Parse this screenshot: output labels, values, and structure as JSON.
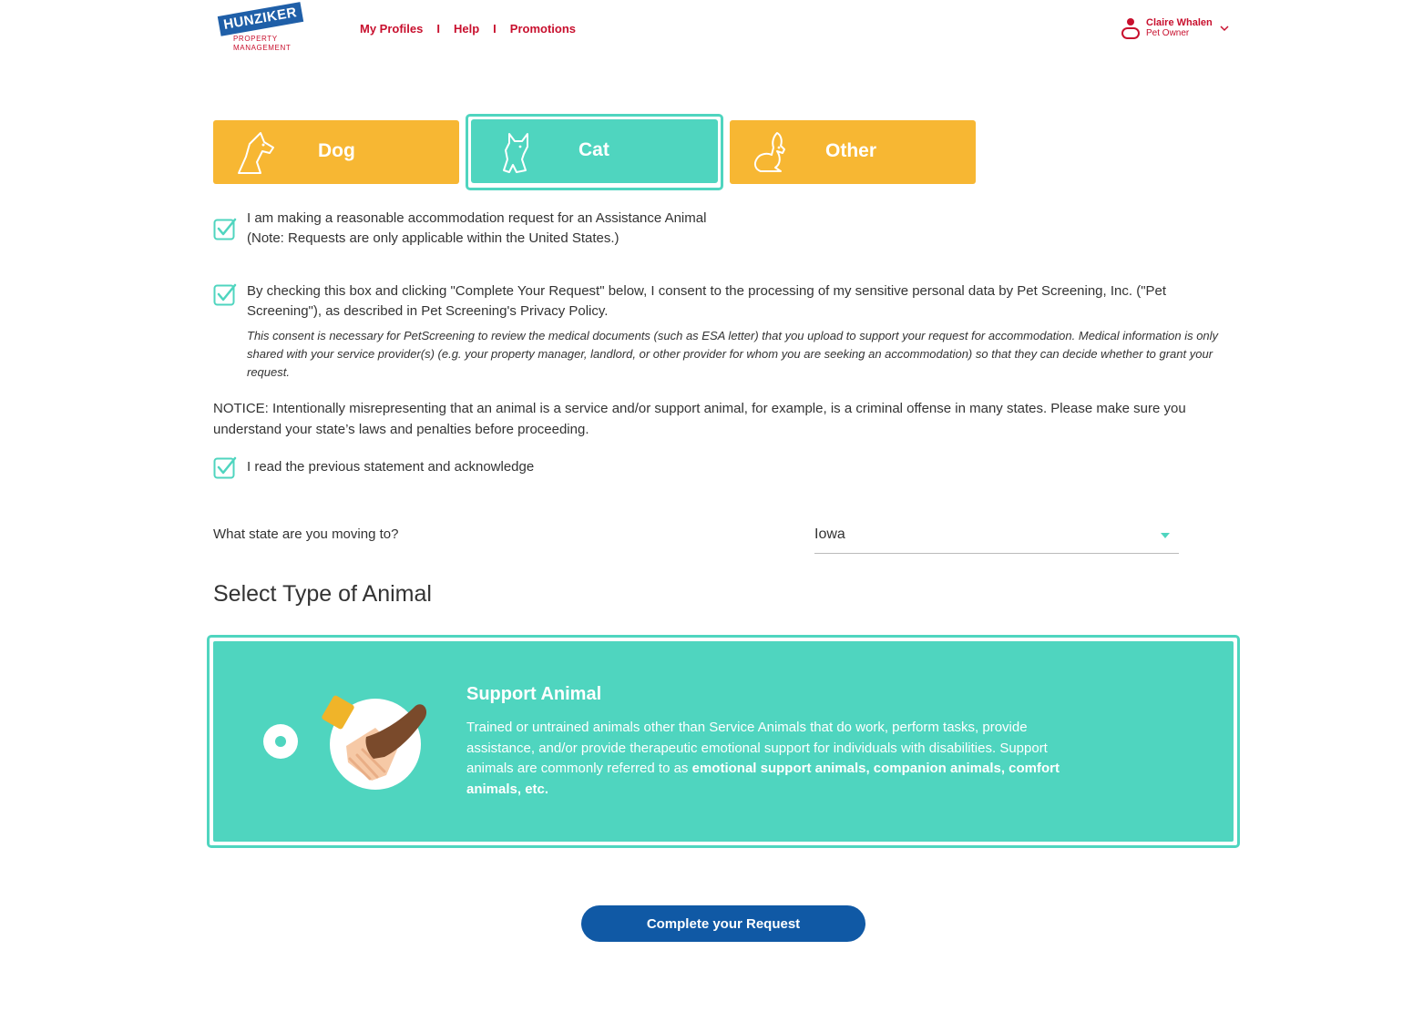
{
  "header": {
    "logo": {
      "brand": "HUNZIKER",
      "sub1": "PROPERTY",
      "sub2": "MANAGEMENT"
    },
    "nav": [
      {
        "label": "My Profiles"
      },
      {
        "label": "Help"
      },
      {
        "label": "Promotions"
      }
    ],
    "separator": "I",
    "user": {
      "name": "Claire Whalen",
      "role": "Pet Owner",
      "icon": "user-icon"
    }
  },
  "pet_types": [
    {
      "label": "Dog",
      "icon": "dog-icon",
      "selected": false
    },
    {
      "label": "Cat",
      "icon": "cat-icon",
      "selected": true
    },
    {
      "label": "Other",
      "icon": "rabbit-icon",
      "selected": false
    }
  ],
  "checkboxes": {
    "accommodation": {
      "checked": true,
      "line1": "I am making a reasonable accommodation request for an Assistance Animal",
      "line2": "(Note: Requests are only applicable within the United States.)"
    },
    "consent": {
      "checked": true,
      "text": "By checking this box and clicking \"Complete Your Request\" below, I consent to the processing of my sensitive personal data by Pet Screening, Inc. (\"Pet Screening\"), as described in Pet Screening's Privacy Policy.",
      "note": "This consent is necessary for PetScreening to review the medical documents (such as ESA letter) that you upload to support your request for accommodation. Medical information is only shared with your service provider(s) (e.g. your property manager, landlord, or other provider for whom you are seeking an accommodation) so that they can decide whether to grant your request."
    },
    "acknowledge": {
      "checked": true,
      "text": "I read the previous statement and acknowledge"
    }
  },
  "notice": "NOTICE: Intentionally misrepresenting that an animal is a service and/or support animal, for example, is a criminal offense in many states. Please make sure you understand your state’s laws and penalties before proceeding.",
  "state": {
    "label": "What state are you moving to?",
    "value": "Iowa"
  },
  "section_title": "Select Type of Animal",
  "animal_option": {
    "title": "Support Animal",
    "desc_plain": "Trained or untrained animals other than Service Animals that do work, perform tasks, provide assistance, and/or provide therapeutic emotional support for individuals with disabilities. Support animals are commonly referred to as ",
    "desc_bold": "emotional support animals, companion animals, comfort animals, etc.",
    "selected": true,
    "icon": "helping-hands-icon"
  },
  "submit_label": "Complete your Request",
  "colors": {
    "brand_red": "#c8102e",
    "teal": "#4fd5bf",
    "yellow": "#f7b733",
    "button_blue": "#1059a5",
    "logo_blue": "#1f5fa8"
  }
}
